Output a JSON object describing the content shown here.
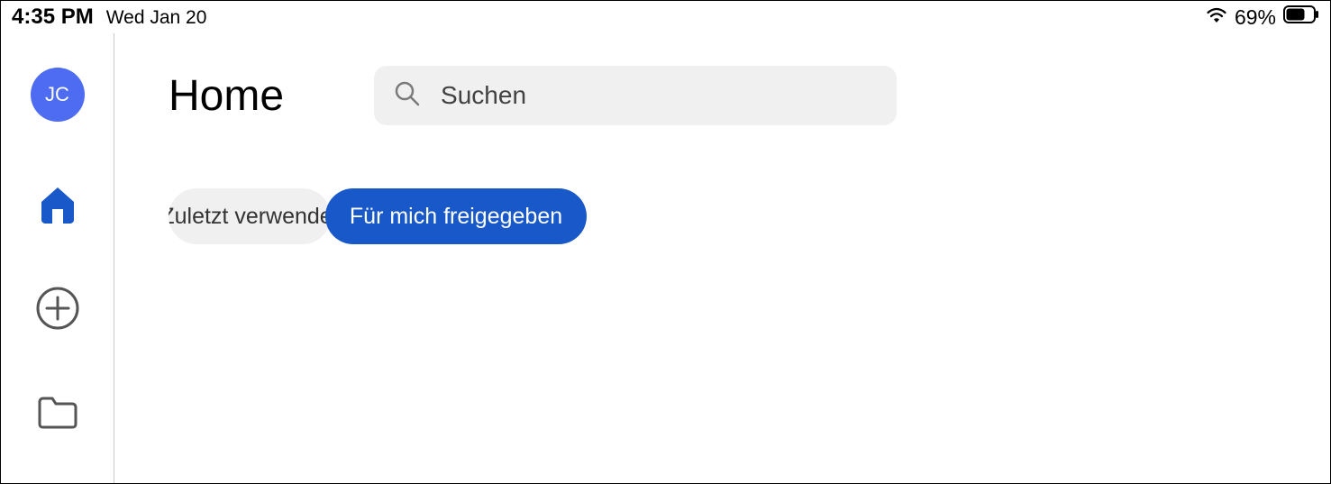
{
  "status_bar": {
    "time": "4:35 PM",
    "date": "Wed Jan 20",
    "battery_pct": "69%"
  },
  "sidebar": {
    "avatar_initials": "JC"
  },
  "header": {
    "title": "Home",
    "search_placeholder": "Suchen"
  },
  "tabs": {
    "recent": "Zuletzt verwendet",
    "shared": "Für mich freigegeben"
  },
  "colors": {
    "accent": "#1858c8",
    "avatar": "#4e6cf1"
  }
}
